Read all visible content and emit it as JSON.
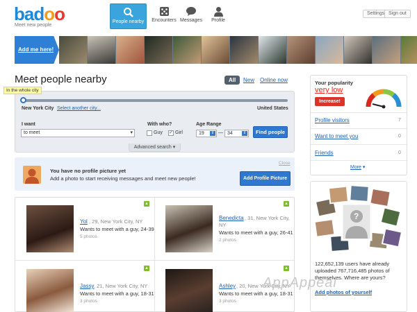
{
  "header": {
    "logo": "badoo",
    "tagline": "Meet new people",
    "settings": "Settings",
    "sign_out": "Sign out",
    "nav": [
      {
        "label": "People nearby",
        "icon": "magnifier-icon"
      },
      {
        "label": "Encounters",
        "icon": "dice-icon"
      },
      {
        "label": "Messages",
        "icon": "speech-bubble-icon"
      },
      {
        "label": "Profile",
        "icon": "person-icon"
      }
    ]
  },
  "strip": {
    "add_me": "Add me here!"
  },
  "main": {
    "title": "Meet people nearby",
    "filters": {
      "all": "All",
      "new": "New",
      "online": "Online now"
    },
    "location": {
      "tip": "In the whole city",
      "city": "New York City",
      "select_other": "Select another city...",
      "country": "United States"
    },
    "form": {
      "i_want_label": "I want",
      "i_want_value": "to meet",
      "with_who_label": "With who?",
      "guy": "Guy",
      "girl": "Girl",
      "girl_checked": true,
      "guy_checked": false,
      "age_label": "Age Range",
      "age_from": "19",
      "age_to": "34",
      "dash": "—",
      "find_button": "Find people",
      "advanced": "Advanced search"
    },
    "notice": {
      "title": "You have no profile picture yet",
      "text": "Add a photo to start receiving messages and meet new people!",
      "button": "Add Profile Picture",
      "close": "Close"
    },
    "cards": [
      {
        "name": "Yol",
        "details": ", 29, New York City, NY",
        "want": "Wants to meet with a guy, 24-39",
        "photos": "5 photos",
        "badge": "▲"
      },
      {
        "name": "Benedicta",
        "details": ", 31, New York City,",
        "details2": "NY",
        "want": "Wants to meet with a guy, 26-41",
        "photos": "2 photos",
        "badge": "▲"
      },
      {
        "name": "Jassy",
        "details": ", 21, New York City, NY",
        "want": "Wants to meet with a guy, 18-31",
        "photos": "3 photos",
        "badge": "▲"
      },
      {
        "name": "Ashley",
        "details": ", 20, New York City, NY",
        "want": "Wants to meet with a guy, 18-31",
        "photos": "3 photos",
        "badge": "▲"
      }
    ]
  },
  "sidebar": {
    "popularity_label": "Your popularity",
    "popularity_value": "very low",
    "increase": "Increase!",
    "links": [
      {
        "label": "Profile visitors",
        "count": "7"
      },
      {
        "label": "Want to meet you",
        "count": "0"
      },
      {
        "label": "Friends",
        "count": "0"
      }
    ],
    "more": "More",
    "promo_text": "122,652,139 users have already uploaded 767,716,485 photos of themselves. Where are yours?",
    "promo_link": "Add photos of yourself"
  },
  "watermark": "AppAppeal",
  "colors": {
    "accent": "#2f77cf",
    "nav_active": "#3aa5dc",
    "popularity": "#e8281f",
    "badge": "#7cbd2a"
  }
}
